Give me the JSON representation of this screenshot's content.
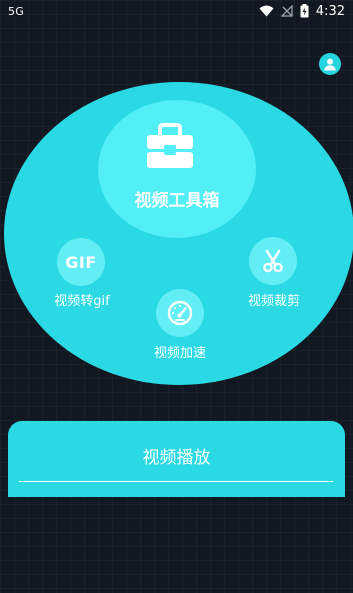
{
  "status_bar": {
    "network": "5G",
    "time": "4:32",
    "wifi_icon": "wifi-icon",
    "signal_icon": "signal-off-icon",
    "battery_icon": "battery-charging-icon"
  },
  "header": {
    "profile_icon": "user-icon"
  },
  "toolbox": {
    "label": "视频工具箱",
    "icon": "toolbox-icon"
  },
  "features": [
    {
      "label": "视频转gif",
      "icon_text": "GIF",
      "icon": "gif-icon"
    },
    {
      "label": "视频裁剪",
      "icon": "scissors-icon"
    },
    {
      "label": "视频加速",
      "icon": "speedometer-icon"
    }
  ],
  "player": {
    "label": "视频播放"
  },
  "colors": {
    "background": "#121821",
    "accent": "#2ad9e3",
    "accent_light": "#52eff7",
    "text": "#ffffff"
  }
}
